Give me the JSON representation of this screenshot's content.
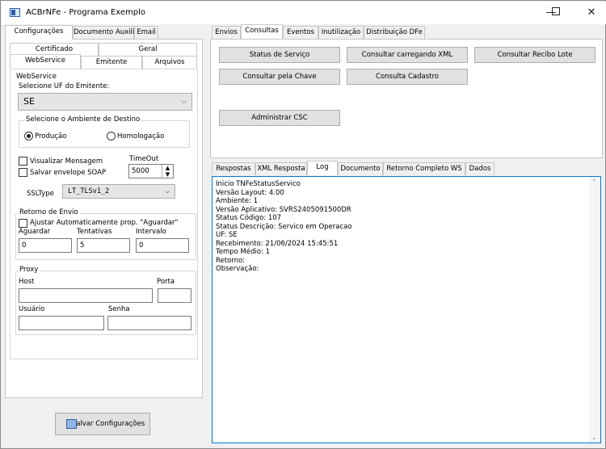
{
  "window": {
    "title": "ACBrNFe - Programa Exemplo",
    "min": "—",
    "max": "☐",
    "close": "✕"
  },
  "left_tabs": [
    "Configurações",
    "Documento Auxiliar",
    "Email"
  ],
  "sub_tabs_row1": [
    "Certificado",
    "Geral"
  ],
  "sub_tabs_row2": [
    "WebService",
    "Emitente",
    "Arquivos"
  ],
  "webservice": {
    "group_title": "WebService",
    "uf_label": "Selecione UF do Emitente:",
    "uf_value": "SE",
    "ambiente_title": "Selecione o Ambiente de Destino",
    "producao": "Produção",
    "homologacao": "Homologação",
    "visualizar": "Visualizar Mensagem",
    "salvar_envelope": "Salvar envelope SOAP",
    "timeout_label": "TimeOut",
    "timeout_value": "5000",
    "ssltype_label": "SSLType",
    "ssltype_value": "LT_TLSv1_2"
  },
  "retorno": {
    "title": "Retorno de Envio",
    "ajustar": "Ajustar Automaticamente prop. \"Aguardar\"",
    "aguardar_label": "Aguardar",
    "tentativas_label": "Tentativas",
    "intervalo_label": "Intervalo",
    "aguardar_value": "0",
    "tentativas_value": "5",
    "intervalo_value": "0"
  },
  "proxy": {
    "title": "Proxy",
    "host": "Host",
    "porta": "Porta",
    "usuario": "Usuário",
    "senha": "Senha"
  },
  "save_button": "Salvar Configurações",
  "right_tabs": [
    "Envios",
    "Consultas",
    "Eventos",
    "Inutilização",
    "Distribuição DFe"
  ],
  "buttons": {
    "status": "Status de Serviço",
    "consultar_xml": "Consultar carregando XML",
    "consultar_recibo": "Consultar Recibo Lote",
    "consultar_chave": "Consultar pela Chave",
    "consulta_cadastro": "Consulta Cadastro",
    "csc": "Administrar CSC"
  },
  "result_tabs": [
    "Respostas",
    "XML Resposta",
    "Log",
    "Documento",
    "Retorno Completo WS",
    "Dados"
  ],
  "log_lines": [
    "Inicio TNFeStatusServico",
    "Versão Layout: 4.00",
    "Ambiente: 1",
    "Versão Aplicativo: SVRS2405091500DR",
    "Status Código: 107",
    "Status Descrição: Servico em Operacao",
    "UF: SE",
    "Recebimento: 21/06/2024 15:45:51",
    "Tempo Médio: 1",
    "Retorno:",
    "Observação:"
  ],
  "colors": {
    "accent": "#0078d7",
    "window_bg": "#f0f0f0"
  }
}
